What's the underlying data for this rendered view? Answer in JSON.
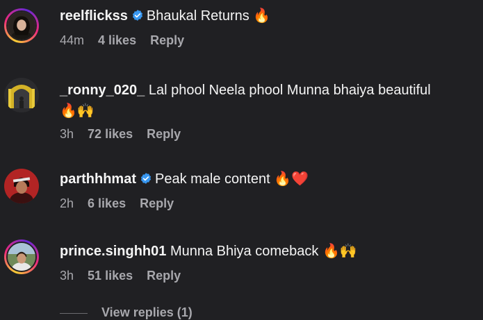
{
  "comments": [
    {
      "username": "reelflickss",
      "verified": true,
      "text": "Bhaukal Returns 🔥",
      "time": "44m",
      "likes": "4 likes",
      "reply": "Reply",
      "avatar_icon": "profile-photo-woman"
    },
    {
      "username": "_ronny_020_",
      "verified": false,
      "text": "Lal phool Neela phool Munna bhaiya beautiful",
      "text_cont": "🔥🙌",
      "time": "3h",
      "likes": "72 likes",
      "reply": "Reply",
      "avatar_icon": "profile-photo-yellow-gate"
    },
    {
      "username": "parthhhmat",
      "verified": true,
      "text": "Peak male content 🔥❤️",
      "time": "2h",
      "likes": "6 likes",
      "reply": "Reply",
      "avatar_icon": "profile-photo-red-man"
    },
    {
      "username": "prince.singhh01",
      "verified": false,
      "text": "Munna Bhiya comeback 🔥🙌",
      "time": "3h",
      "likes": "51 likes",
      "reply": "Reply",
      "avatar_icon": "profile-photo-man"
    }
  ],
  "view_replies": "View replies (1)",
  "colors": {
    "background": "#202023",
    "text": "#f5f5f5",
    "muted": "#a8a8ad",
    "verified": "#3897f0"
  }
}
